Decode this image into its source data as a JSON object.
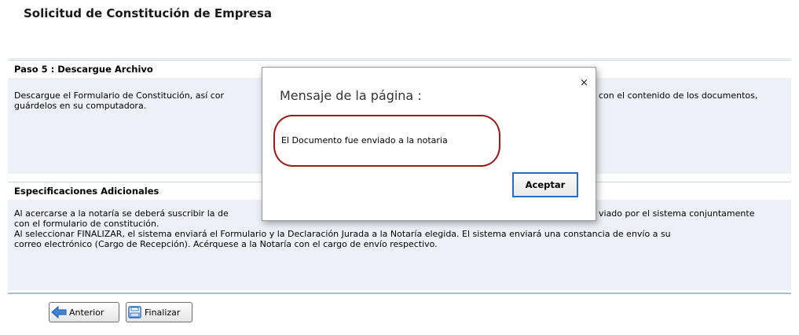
{
  "page": {
    "title": "Solicitud de Constitución de Empresa"
  },
  "step5": {
    "header": "Paso 5 : Descargue Archivo",
    "line1_left": "Descargue el Formulario de Constitución, así cor",
    "line1_right": "con el contenido de los documentos,",
    "line2": "guárdelos en su computadora."
  },
  "specs": {
    "header": "Especificaciones Adicionales",
    "line1_left": "Al acercarse a la notaría se deberá suscribir la de",
    "line1_right": "viado por el sistema conjuntamente",
    "line2": "con el formulario de constitución.",
    "line3": "Al seleccionar FINALIZAR, el sistema enviará el Formulario y la Declaración Jurada a la Notaría elegida. El sistema enviará una constancia de envío a su",
    "line4": "correo electrónico (Cargo de Recepción). Acérquese a la Notaría con el cargo de envío respectivo."
  },
  "buttons": {
    "previous_label": "Anterior",
    "finish_label": "Finalizar"
  },
  "icons": {
    "previous": "left-arrow-icon",
    "finish": "save-icon",
    "close": "close-icon"
  },
  "dialog": {
    "title": "Mensaje de la página :",
    "close_glyph": "×",
    "message": "El Documento fue enviado a la notaria",
    "accept_label": "Aceptar"
  },
  "colors": {
    "section_body": "#edf1f7",
    "highlight_ring": "#9b1a1a",
    "focus_border": "#2a6ac0"
  }
}
